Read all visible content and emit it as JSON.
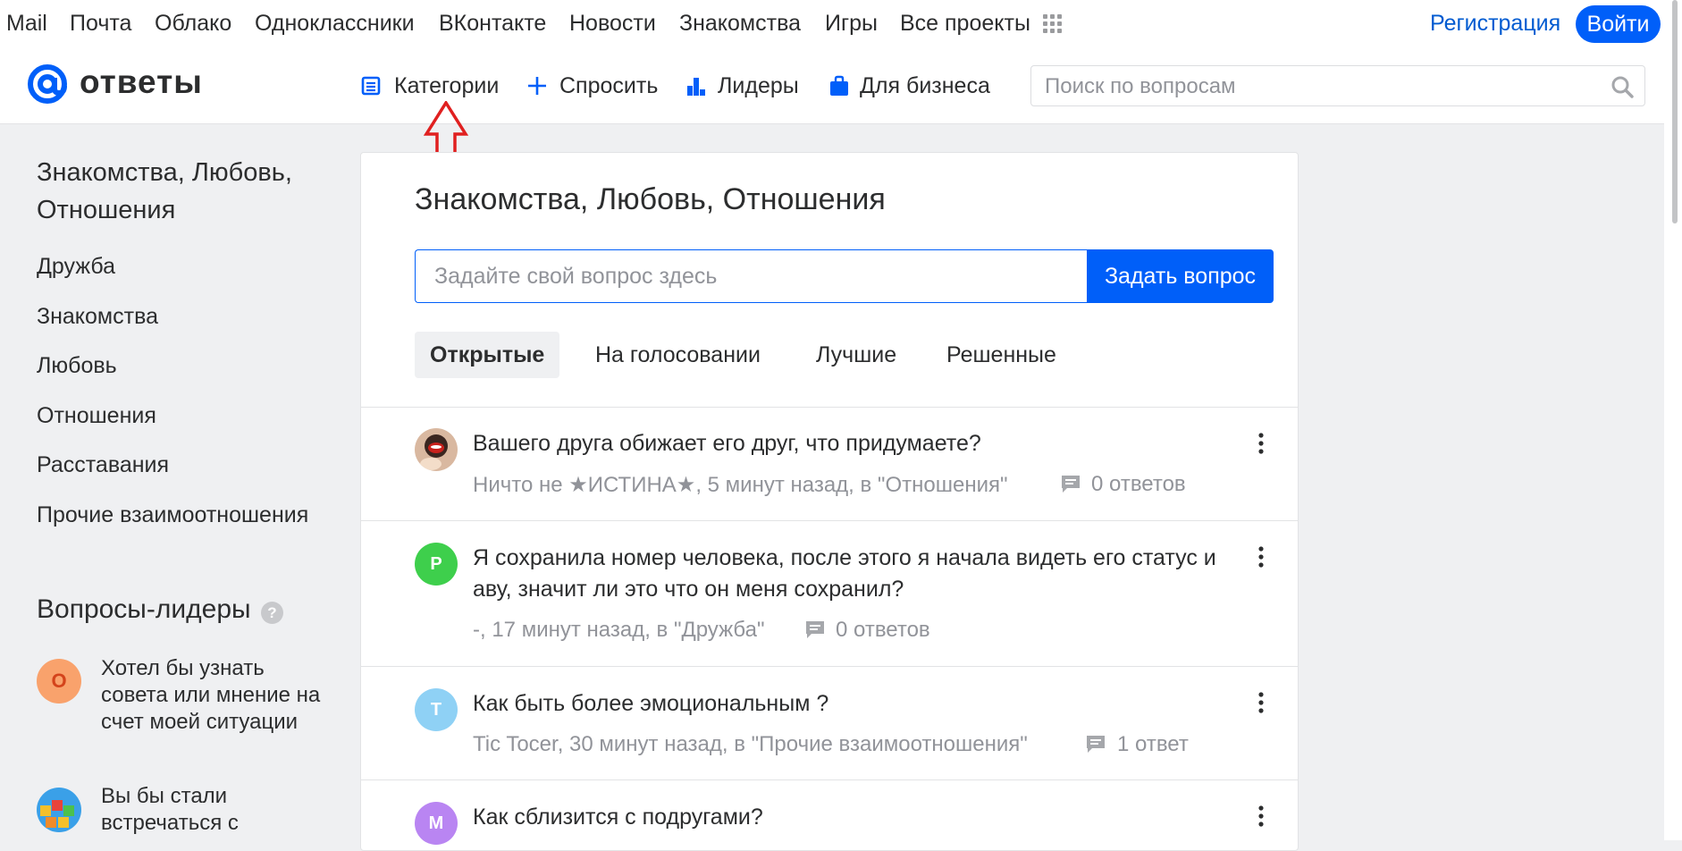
{
  "portal": {
    "links": [
      "Mail",
      "Почта",
      "Облако",
      "Одноклассники",
      "ВКонтакте",
      "Новости",
      "Знакомства",
      "Игры",
      "Все проекты"
    ],
    "register": "Регистрация",
    "login": "Войти"
  },
  "header": {
    "logo_text": "ответы",
    "nav": [
      "Категории",
      "Спросить",
      "Лидеры",
      "Для бизнеса"
    ],
    "search_placeholder": "Поиск по вопросам"
  },
  "sidebar": {
    "category_title": "Знакомства, Любовь, Отношения",
    "subcategories": [
      "Дружба",
      "Знакомства",
      "Любовь",
      "Отношения",
      "Расставания",
      "Прочие взаимоотношения"
    ],
    "leaders_title": "Вопросы-лидеры",
    "help_glyph": "?",
    "leaders": [
      {
        "avatar_letter": "О",
        "text": "Хотел бы узнать совета или мнение на счет моей ситуации"
      },
      {
        "avatar_letter": "",
        "text": "Вы бы стали встречаться с"
      }
    ]
  },
  "main": {
    "title": "Знакомства, Любовь, Отношения",
    "ask_placeholder": "Задайте свой вопрос здесь",
    "ask_button": "Задать вопрос",
    "tabs": [
      "Открытые",
      "На голосовании",
      "Лучшие",
      "Решенные"
    ],
    "active_tab": "Открытые",
    "questions": [
      {
        "avatar_letter": "",
        "title": "Вашего друга обижает его друг, что придумаете?",
        "meta": "Ничто не ★ИСТИНА★, 5 минут назад, в \"Отношения\"",
        "answers": "0 ответов"
      },
      {
        "avatar_letter": "Р",
        "title": "Я сохранила номер человека, после этого я начала видеть его статус и аву, значит ли это что он меня сохранил?",
        "meta": "-, 17 минут назад, в \"Дружба\"",
        "answers": "0 ответов"
      },
      {
        "avatar_letter": "Т",
        "title": "Как быть более эмоциональным ?",
        "meta": "Tic Tocer, 30 минут назад, в \"Прочие взаимоотношения\"",
        "answers": "1 ответ"
      },
      {
        "avatar_letter": "М",
        "title": "Как сблизится с подругами?",
        "meta": "",
        "answers": ""
      }
    ]
  },
  "colors": {
    "accent": "#005ff9",
    "link": "#005bd1",
    "annotation_arrow": "#e02020",
    "avatar_p": "#3ecf4c",
    "avatar_t": "#8fd1f5",
    "avatar_m": "#b985f2",
    "avatar_o": "#f9a26c"
  }
}
